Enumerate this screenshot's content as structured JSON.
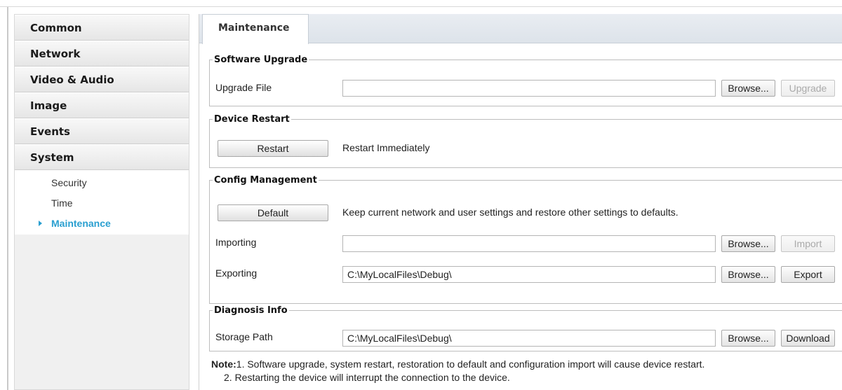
{
  "sidebar": {
    "sections": [
      "Common",
      "Network",
      "Video & Audio",
      "Image",
      "Events",
      "System"
    ],
    "sub_items": [
      "Security",
      "Time",
      "Maintenance"
    ],
    "active_sub_item": "Maintenance"
  },
  "main": {
    "tab_label": "Maintenance",
    "software_upgrade": {
      "legend": "Software Upgrade",
      "label": "Upgrade File",
      "value": "",
      "browse_label": "Browse...",
      "upgrade_label": "Upgrade"
    },
    "device_restart": {
      "legend": "Device Restart",
      "restart_label": "Restart",
      "description": "Restart Immediately"
    },
    "config_management": {
      "legend": "Config Management",
      "default_label": "Default",
      "default_description": "Keep current network and user settings and restore other settings to defaults.",
      "importing_label": "Importing",
      "importing_value": "",
      "import_browse_label": "Browse...",
      "import_label": "Import",
      "exporting_label": "Exporting",
      "exporting_value": "C:\\MyLocalFiles\\Debug\\",
      "export_browse_label": "Browse...",
      "export_label": "Export"
    },
    "diagnosis_info": {
      "legend": "Diagnosis Info",
      "storage_label": "Storage Path",
      "storage_value": "C:\\MyLocalFiles\\Debug\\",
      "browse_label": "Browse...",
      "download_label": "Download"
    },
    "note": {
      "prefix": "Note:",
      "line1": "1. Software upgrade, system restart, restoration to default and configuration import will cause device restart.",
      "line2": "2. Restarting the device will interrupt the connection to the device."
    }
  },
  "colors": {
    "accent": "#2a9fd0",
    "sidebar_bg": "#f0f0f0",
    "tabbar_bg": "#e4e9ef"
  }
}
